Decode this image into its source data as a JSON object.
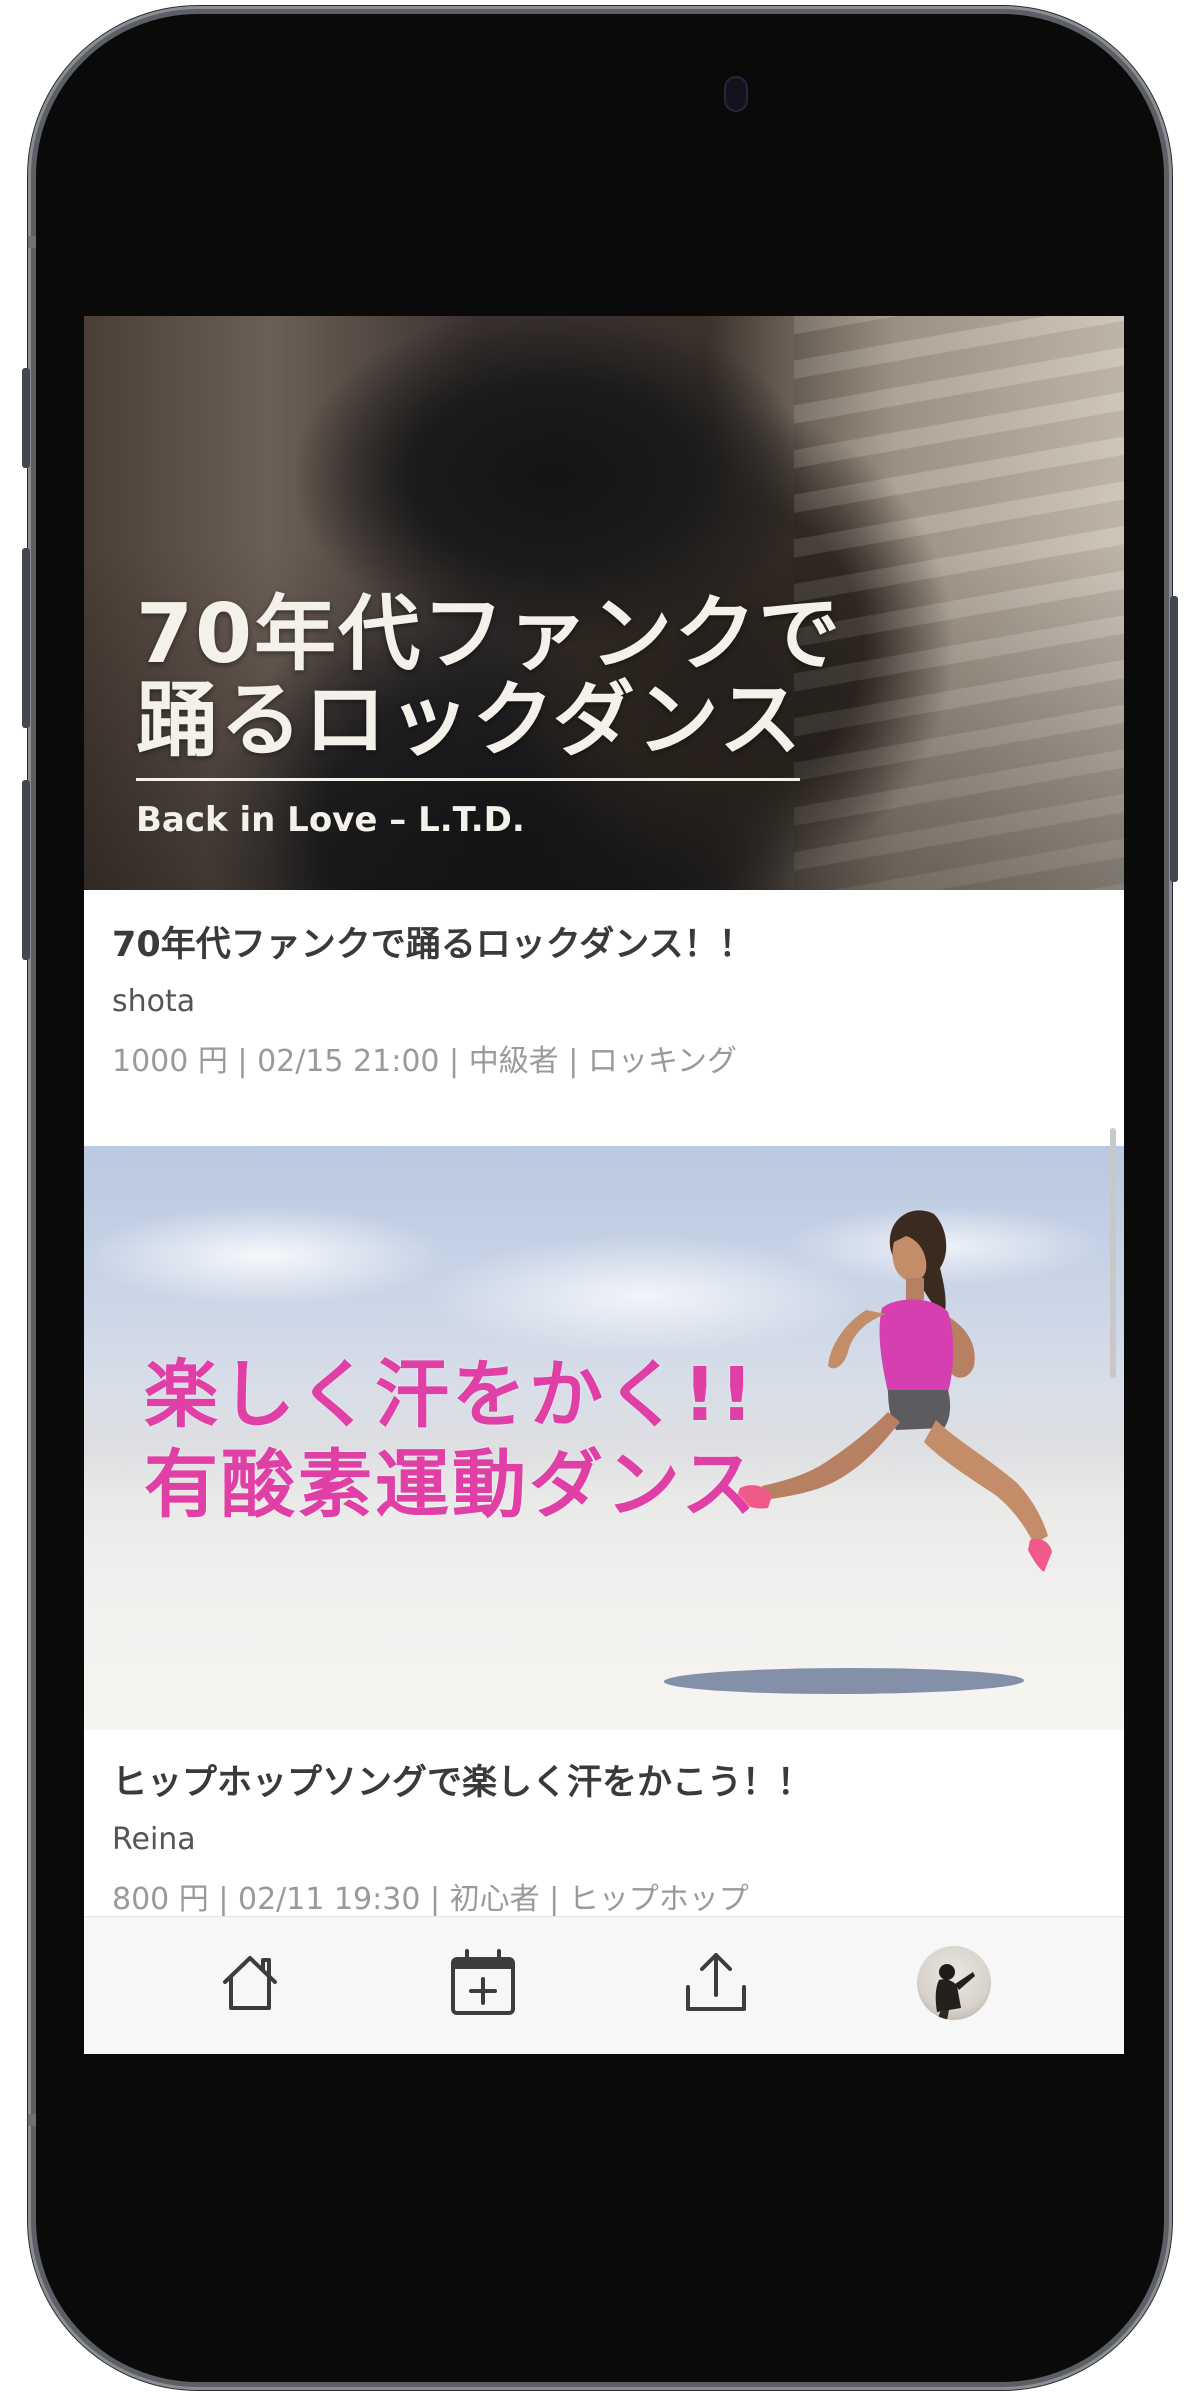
{
  "feed": {
    "cards": [
      {
        "banner_line1": "70年代ファンクで",
        "banner_line2": "踊るロックダンス",
        "banner_sub": "Back in Love – L.T.D.",
        "title": "70年代ファンクで踊るロックダンス！！",
        "author": "shota",
        "meta": "1000 円 | 02/15 21:00 | 中級者 | ロッキング"
      },
      {
        "banner_line1": "楽しく汗をかく!!",
        "banner_line2": "有酸素運動ダンス",
        "title": "ヒップホップソングで楽しく汗をかこう！！",
        "author": "Reina",
        "meta": "800 円 | 02/11 19:30 | 初心者 | ヒップホップ"
      }
    ]
  },
  "bottom_nav": {
    "items": [
      {
        "icon": "home-icon"
      },
      {
        "icon": "calendar-add-icon"
      },
      {
        "icon": "upload-icon"
      },
      {
        "icon": "profile-avatar"
      }
    ]
  },
  "colors": {
    "promo_pink": "#e03fa6",
    "title_text": "#3a3a3a",
    "meta_text": "#9a9a9a",
    "nav_background": "#f7f7f7"
  }
}
